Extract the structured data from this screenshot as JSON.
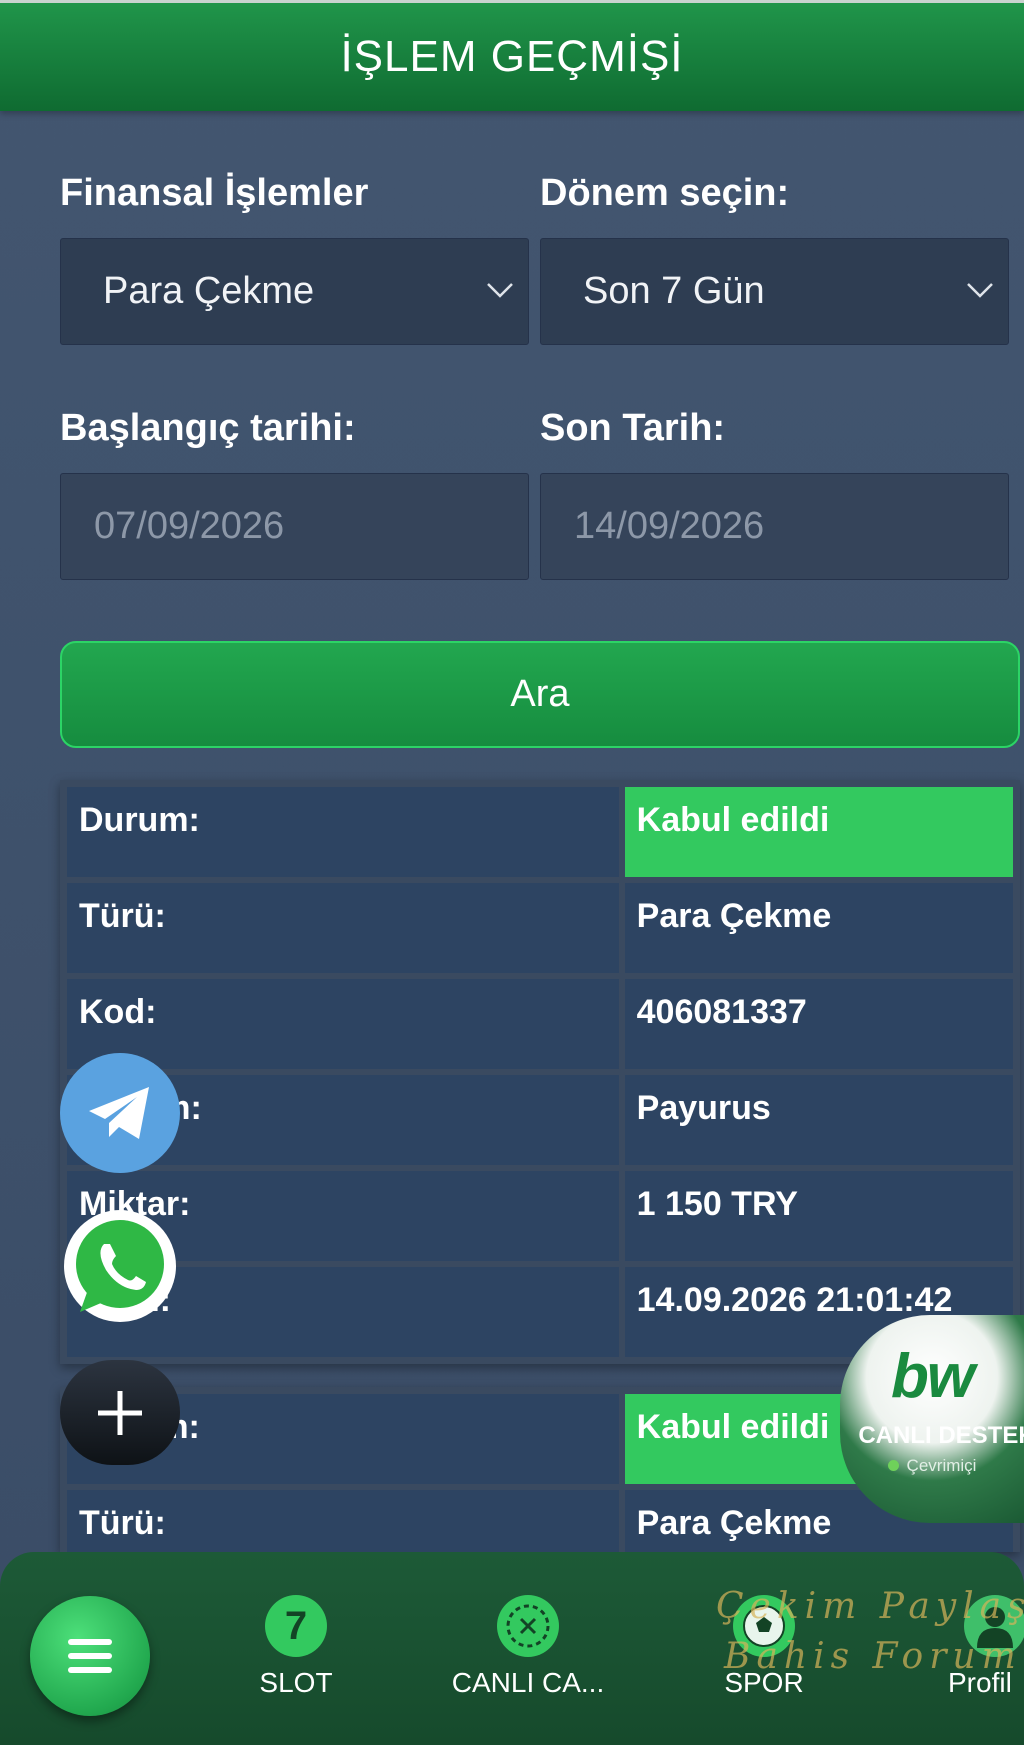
{
  "header": {
    "title": "İŞLEM GEÇMİŞİ"
  },
  "filters": {
    "type_label": "Finansal İşlemler",
    "type_value": "Para Çekme",
    "period_label": "Dönem seçin:",
    "period_value": "Son 7 Gün",
    "start_label": "Başlangıç tarihi:",
    "start_value": "07/09/2026",
    "end_label": "Son Tarih:",
    "end_value": "14/09/2026",
    "search_label": "Ara"
  },
  "transactions": [
    {
      "rows": [
        {
          "key": "Durum:",
          "value": "Kabul edildi"
        },
        {
          "key": "Türü:",
          "value": "Para Çekme"
        },
        {
          "key": "Kod:",
          "value": "406081337"
        },
        {
          "key": "Sistem:",
          "value": "Payurus"
        },
        {
          "key": "Miktar:",
          "value": "1 150 TRY"
        },
        {
          "key": "Tarih:",
          "value": "14.09.2026 21:01:42"
        }
      ]
    },
    {
      "rows": [
        {
          "key": "Durum:",
          "value": "Kabul edildi"
        },
        {
          "key": "Türü:",
          "value": "Para Çekme"
        }
      ]
    }
  ],
  "live_support": {
    "logo": "bw",
    "title": "CANLI DESTEK",
    "status": "Çevrimiçi"
  },
  "bottom_nav": {
    "items": [
      {
        "label": "SLOT",
        "icon": "seven-icon"
      },
      {
        "label": "CANLI CA...",
        "icon": "roulette-chip-icon"
      },
      {
        "label": "SPOR",
        "icon": "soccer-ball-icon"
      },
      {
        "label": "Profil",
        "icon": "user-icon"
      }
    ]
  },
  "watermark": {
    "line1": "Çekim Paylaş",
    "line2": "Bahis Forum"
  },
  "colors": {
    "accent": "#33c95f",
    "header": "#1b8a43",
    "panel": "#2d4462"
  }
}
